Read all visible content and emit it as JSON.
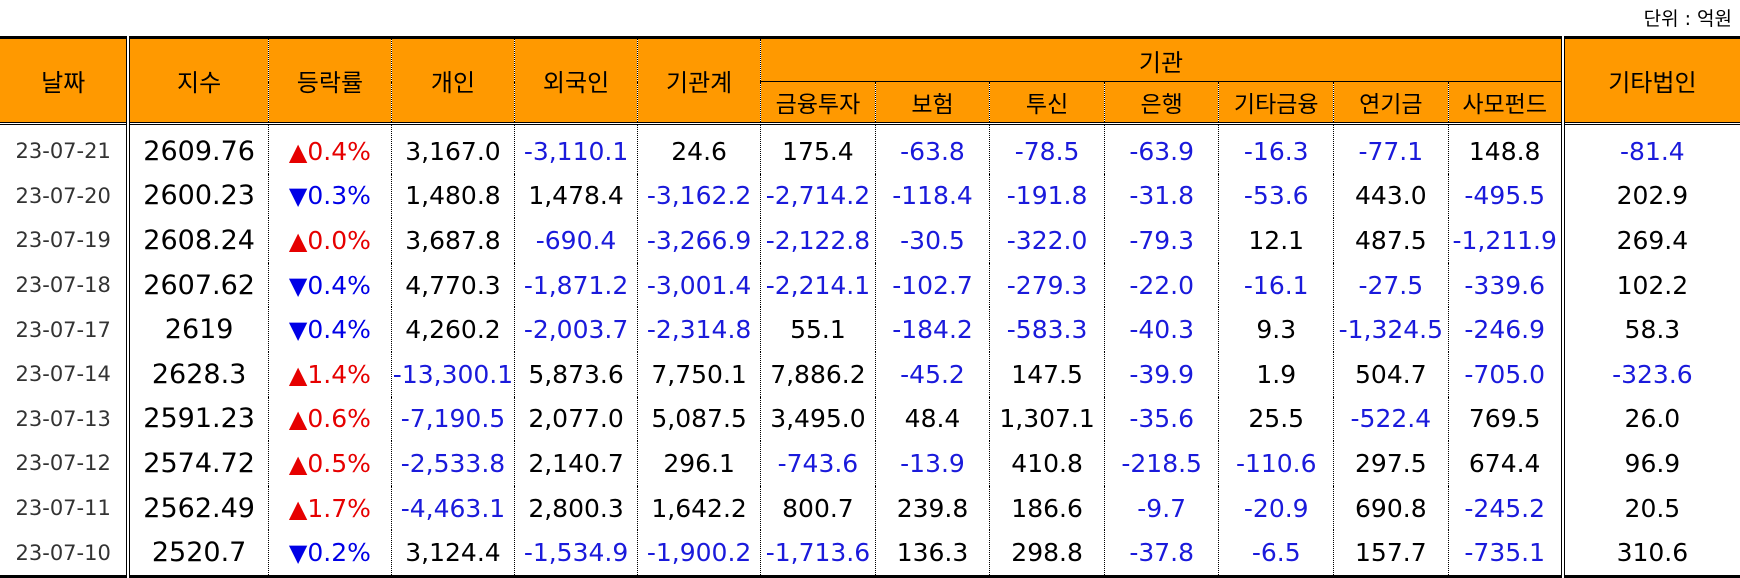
{
  "unit_label": "단위 : 억원",
  "headers": {
    "date": "날짜",
    "index": "지수",
    "change": "등락률",
    "individual": "개인",
    "foreign": "외국인",
    "inst_total": "기관계",
    "institution": "기관",
    "sub": [
      "금융투자",
      "보험",
      "투신",
      "은행",
      "기타금융",
      "연기금",
      "사모펀드"
    ],
    "other_corp": "기타법인"
  },
  "rows": [
    {
      "date": "23-07-21",
      "index": "2609.76",
      "dir": "up",
      "change": "0.4%",
      "values": [
        "3,167.0",
        "-3,110.1",
        "24.6",
        "175.4",
        "-63.8",
        "-78.5",
        "-63.9",
        "-16.3",
        "-77.1",
        "148.8",
        "-81.4"
      ]
    },
    {
      "date": "23-07-20",
      "index": "2600.23",
      "dir": "down",
      "change": "0.3%",
      "values": [
        "1,480.8",
        "1,478.4",
        "-3,162.2",
        "-2,714.2",
        "-118.4",
        "-191.8",
        "-31.8",
        "-53.6",
        "443.0",
        "-495.5",
        "202.9"
      ]
    },
    {
      "date": "23-07-19",
      "index": "2608.24",
      "dir": "up",
      "change": "0.0%",
      "values": [
        "3,687.8",
        "-690.4",
        "-3,266.9",
        "-2,122.8",
        "-30.5",
        "-322.0",
        "-79.3",
        "12.1",
        "487.5",
        "-1,211.9",
        "269.4"
      ]
    },
    {
      "date": "23-07-18",
      "index": "2607.62",
      "dir": "down",
      "change": "0.4%",
      "values": [
        "4,770.3",
        "-1,871.2",
        "-3,001.4",
        "-2,214.1",
        "-102.7",
        "-279.3",
        "-22.0",
        "-16.1",
        "-27.5",
        "-339.6",
        "102.2"
      ]
    },
    {
      "date": "23-07-17",
      "index": "2619",
      "dir": "down",
      "change": "0.4%",
      "values": [
        "4,260.2",
        "-2,003.7",
        "-2,314.8",
        "55.1",
        "-184.2",
        "-583.3",
        "-40.3",
        "9.3",
        "-1,324.5",
        "-246.9",
        "58.3"
      ]
    },
    {
      "date": "23-07-14",
      "index": "2628.3",
      "dir": "up",
      "change": "1.4%",
      "values": [
        "-13,300.1",
        "5,873.6",
        "7,750.1",
        "7,886.2",
        "-45.2",
        "147.5",
        "-39.9",
        "1.9",
        "504.7",
        "-705.0",
        "-323.6"
      ]
    },
    {
      "date": "23-07-13",
      "index": "2591.23",
      "dir": "up",
      "change": "0.6%",
      "values": [
        "-7,190.5",
        "2,077.0",
        "5,087.5",
        "3,495.0",
        "48.4",
        "1,307.1",
        "-35.6",
        "25.5",
        "-522.4",
        "769.5",
        "26.0"
      ]
    },
    {
      "date": "23-07-12",
      "index": "2574.72",
      "dir": "up",
      "change": "0.5%",
      "values": [
        "-2,533.8",
        "2,140.7",
        "296.1",
        "-743.6",
        "-13.9",
        "410.8",
        "-218.5",
        "-110.6",
        "297.5",
        "674.4",
        "96.9"
      ]
    },
    {
      "date": "23-07-11",
      "index": "2562.49",
      "dir": "up",
      "change": "1.7%",
      "values": [
        "-4,463.1",
        "2,800.3",
        "1,642.2",
        "800.7",
        "239.8",
        "186.6",
        "-9.7",
        "-20.9",
        "690.8",
        "-245.2",
        "20.5"
      ]
    },
    {
      "date": "23-07-10",
      "index": "2520.7",
      "dir": "down",
      "change": "0.2%",
      "values": [
        "3,124.4",
        "-1,534.9",
        "-1,900.2",
        "-1,713.6",
        "136.3",
        "298.8",
        "-37.8",
        "-6.5",
        "157.7",
        "-735.1",
        "310.6"
      ]
    }
  ],
  "arrows": {
    "up": "▲",
    "down": "▼"
  },
  "colors": {
    "header_bg": "#FF9900",
    "negative": "#1A1ADB",
    "rise": "#E60000",
    "fall": "#0000E6"
  }
}
